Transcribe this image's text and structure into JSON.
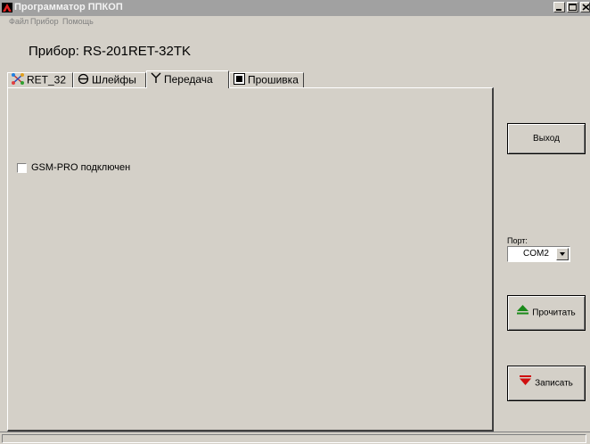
{
  "window": {
    "title": "Программатор ППКОП"
  },
  "menu": {
    "items": [
      {
        "label": "Файл"
      },
      {
        "label": "Прибор"
      },
      {
        "label": "Помощь"
      }
    ]
  },
  "device": {
    "label": "Прибор: RS-201RET-32TK"
  },
  "tabs": [
    {
      "label": "RET_32",
      "icon": "network-icon"
    },
    {
      "label": "Шлейфы",
      "icon": "loop-icon"
    },
    {
      "label": "Передача",
      "icon": "antenna-icon",
      "active": true
    },
    {
      "label": "Прошивка",
      "icon": "chip-icon"
    }
  ],
  "panel": {
    "gsm_checkbox_label": "GSM-PRO подключен",
    "gsm_checked": false
  },
  "side": {
    "exit_label": "Выход",
    "port_label": "Порт:",
    "port_value": "COM2",
    "read_label": "Прочитать",
    "write_label": "Записать"
  },
  "colors": {
    "face": "#d4d0c8",
    "titlebar": "#a1a1a1",
    "read_icon": "#1a8a1a",
    "write_icon": "#d01010"
  }
}
